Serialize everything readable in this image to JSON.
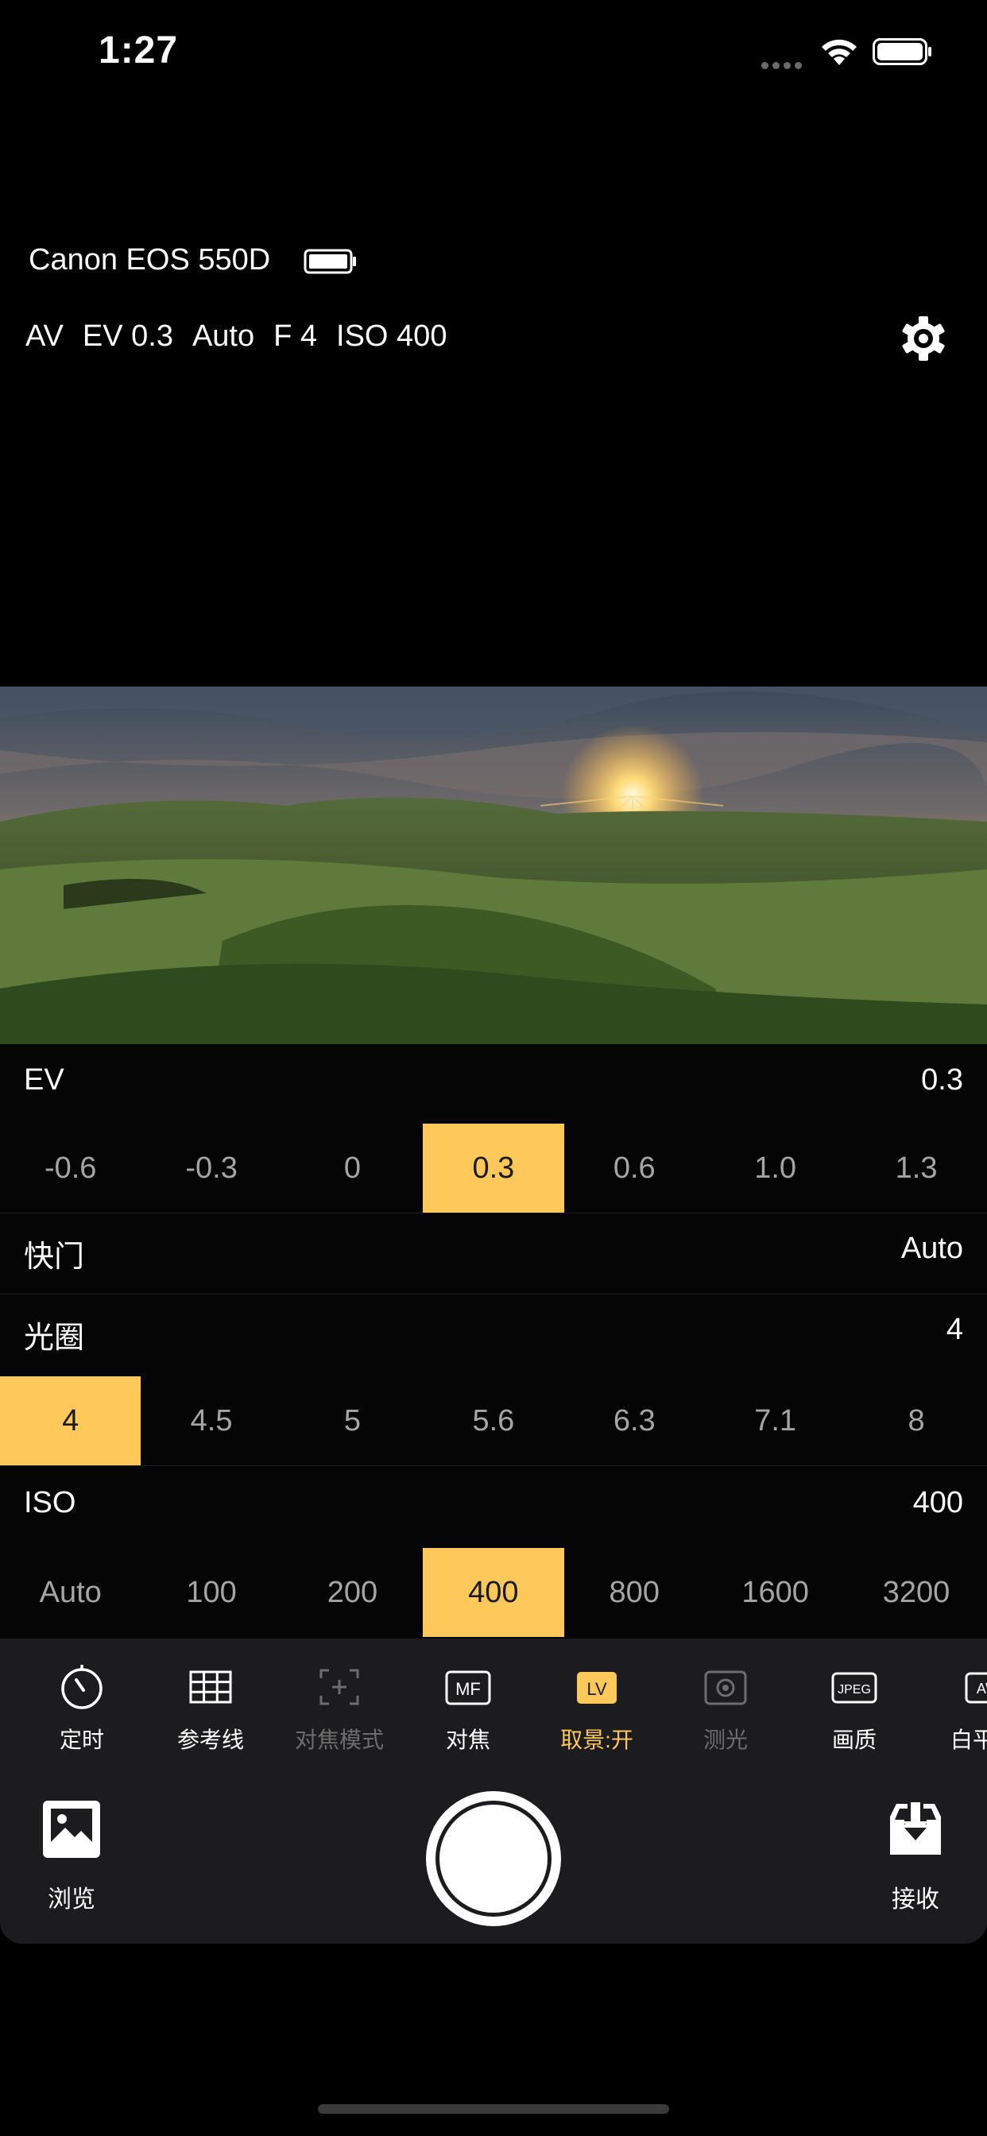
{
  "status_bar": {
    "time": "1:27"
  },
  "camera": {
    "name": "Canon EOS 550D",
    "summary": [
      "AV",
      "EV 0.3",
      "Auto",
      "F 4",
      "ISO 400"
    ]
  },
  "ev": {
    "label": "EV",
    "value": "0.3",
    "options": [
      "-0.6",
      "-0.3",
      "0",
      "0.3",
      "0.6",
      "1.0",
      "1.3"
    ],
    "selected": "0.3"
  },
  "shutter": {
    "label": "快门",
    "value": "Auto"
  },
  "aperture": {
    "label": "光圈",
    "value": "4",
    "options": [
      "4",
      "4.5",
      "5",
      "5.6",
      "6.3",
      "7.1",
      "8"
    ],
    "selected": "4"
  },
  "iso": {
    "label": "ISO",
    "value": "400",
    "options": [
      "Auto",
      "100",
      "200",
      "400",
      "800",
      "1600",
      "3200"
    ],
    "selected": "400"
  },
  "toolbar": {
    "items": [
      {
        "label": "定时",
        "icon": "timer-icon",
        "state": "normal"
      },
      {
        "label": "参考线",
        "icon": "grid-icon",
        "state": "normal"
      },
      {
        "label": "对焦模式",
        "icon": "focus-mode-icon",
        "state": "disabled"
      },
      {
        "label": "对焦",
        "icon": "mf-icon",
        "icon_text": "MF",
        "state": "normal"
      },
      {
        "label": "取景:开",
        "icon": "live-view-icon",
        "icon_text": "LV",
        "state": "active"
      },
      {
        "label": "测光",
        "icon": "metering-icon",
        "state": "disabled"
      },
      {
        "label": "画质",
        "icon": "jpeg-icon",
        "icon_text": "JPEG",
        "state": "normal"
      },
      {
        "label": "白平",
        "icon": "white-balance-icon",
        "icon_text": "AW",
        "state": "normal"
      }
    ],
    "browse_label": "浏览",
    "receive_label": "接收"
  },
  "colors": {
    "accent": "#FFC85A",
    "panel": "#1c1c1e",
    "background": "#000000"
  }
}
